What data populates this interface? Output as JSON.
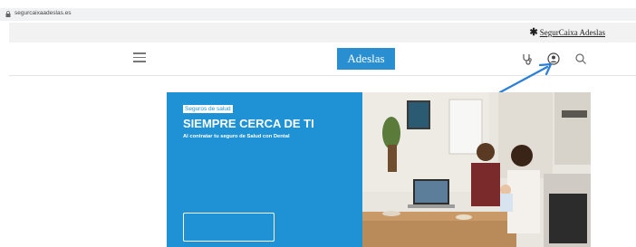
{
  "browser": {
    "url": "segurcaixaadeslas.es"
  },
  "corporate": {
    "brand": "SegurCaixa Adeslas"
  },
  "nav": {
    "logo": "Adeslas"
  },
  "hero": {
    "tag": "Seguros de salud",
    "title": "SIEMPRE CERCA DE TI",
    "subtitle": "Al contratar tu seguro de Salud con Dental",
    "cta_label": ""
  },
  "colors": {
    "accent": "#1f92d6",
    "logo_bg": "#2a8fd0",
    "annotation_arrow": "#2b7fd6"
  },
  "icons": [
    "lock-icon",
    "menu-icon",
    "stethoscope-icon",
    "user-icon",
    "search-icon",
    "annotation-arrow"
  ]
}
